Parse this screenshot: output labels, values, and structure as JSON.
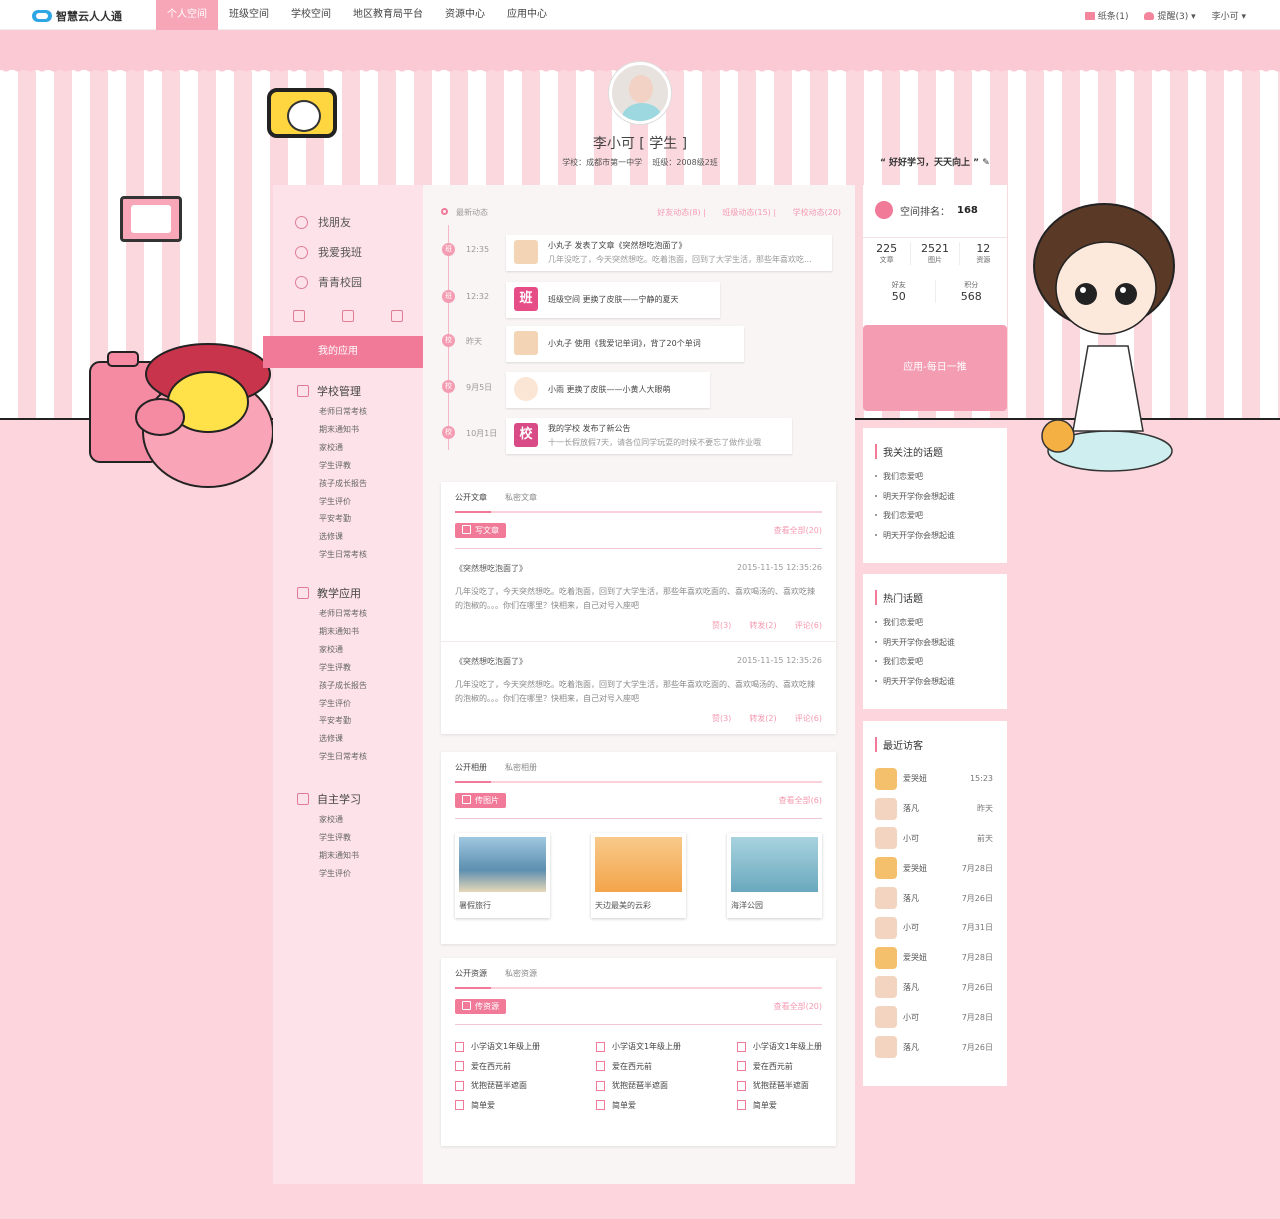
{
  "topnav": {
    "logo": "智慧云人人通",
    "items": [
      "个人空间",
      "班级空间",
      "学校空间",
      "地区教育局平台",
      "资源中心",
      "应用中心"
    ],
    "active_index": 0,
    "mail": "纸条(1)",
    "remind": "提醒(3)",
    "user": "李小可"
  },
  "profile": {
    "name": "李小可 [ 学生 ]",
    "school": "学校：成都市第一中学",
    "class": "班级：2008级2班",
    "motto": "“ 好好学习，天天向上 ”"
  },
  "sidebar": {
    "links": [
      "找朋友",
      "我爱我班",
      "青青校园"
    ],
    "myapp": "我的应用",
    "groups": [
      {
        "title": "学校管理",
        "items": [
          "老师日常考核",
          "期末通知书",
          "家校通",
          "学生评教",
          "孩子成长报告",
          "学生评价",
          "平安考勤",
          "选修课",
          "学生日常考核"
        ]
      },
      {
        "title": "教学应用",
        "items": [
          "老师日常考核",
          "期末通知书",
          "家校通",
          "学生评教",
          "孩子成长报告",
          "学生评价",
          "平安考勤",
          "选修课",
          "学生日常考核"
        ]
      },
      {
        "title": "自主学习",
        "items": [
          "家校通",
          "学生评教",
          "期末通知书",
          "学生评价"
        ]
      }
    ]
  },
  "timeline": {
    "head": "最新动态",
    "tabs": [
      "好友动态(8)",
      "班级动态(15)",
      "学校动态(20)"
    ],
    "items": [
      {
        "badge": "班",
        "time": "12:35",
        "line1": "小丸子  发表了文章《突然想吃泡面了》",
        "line2": "几年没吃了，今天突然想吃。吃着泡面，回到了大学生活，那些年喜欢吃..."
      },
      {
        "badge": "班",
        "time": "12:32",
        "line1": "班级空间    更换了皮肤——宁静的夏天",
        "avatar_text": "班"
      },
      {
        "badge": "校",
        "time": "昨天",
        "line1": "小丸子    使用《我爱记单词》，背了20个单词"
      },
      {
        "badge": "校",
        "time": "9月5日",
        "line1": "小雨    更换了皮肤——小黄人大眼萌"
      },
      {
        "badge": "校",
        "time": "10月1日",
        "line1": "我的学校  发布了新公告",
        "line2": "十一长假放假7天，请各位同学玩耍的时候不要忘了做作业哦",
        "avatar_text": "校"
      }
    ]
  },
  "articles": {
    "tabs": [
      "公开文章",
      "私密文章"
    ],
    "button": "写文章",
    "view_all": "查看全部(20)",
    "list": [
      {
        "title": "《突然想吃泡面了》",
        "date": "2015-11-15  12:35:26",
        "body": "几年没吃了，今天突然想吃。吃着泡面，回到了大学生活，那些年喜欢吃面的、喜欢喝汤的、喜欢吃辣的泡椒的。。。你们在哪里？快相来，自己对号入座吧",
        "stats": [
          "赞(3)",
          "转发(2)",
          "评论(6)"
        ]
      },
      {
        "title": "《突然想吃泡面了》",
        "date": "2015-11-15  12:35:26",
        "body": "几年没吃了，今天突然想吃。吃着泡面，回到了大学生活，那些年喜欢吃面的、喜欢喝汤的、喜欢吃辣的泡椒的。。。你们在哪里？快相来，自己对号入座吧",
        "stats": [
          "赞(3)",
          "转发(2)",
          "评论(6)"
        ]
      }
    ]
  },
  "albums": {
    "tabs": [
      "公开相册",
      "私密相册"
    ],
    "button": "传图片",
    "view_all": "查看全部(6)",
    "photos": [
      {
        "caption": "暑假旅行",
        "color": "#5d8fb0"
      },
      {
        "caption": "天边最美的云彩",
        "color": "#f3a54a"
      },
      {
        "caption": "海洋公园",
        "color": "#6aa8bd"
      }
    ]
  },
  "resources": {
    "tabs": [
      "公开资源",
      "私密资源"
    ],
    "button": "传资源",
    "view_all": "查看全部(20)",
    "columns": [
      [
        "小学语文1年级上册",
        "爱在西元前",
        "犹抱琵琶半遮面",
        "简单爱"
      ],
      [
        "小学语文1年级上册",
        "爱在西元前",
        "犹抱琵琶半遮面",
        "简单爱"
      ],
      [
        "小学语文1年级上册",
        "爱在西元前",
        "犹抱琵琶半遮面",
        "简单爱"
      ]
    ]
  },
  "rank": {
    "label": "空间排名：",
    "value": "168",
    "stats": [
      {
        "n": "225",
        "l": "文章"
      },
      {
        "n": "2521",
        "l": "图片"
      },
      {
        "n": "12",
        "l": "资源"
      }
    ],
    "stats2": [
      {
        "l": "好友",
        "n": "50"
      },
      {
        "l": "积分",
        "n": "568"
      }
    ],
    "push": "应用-每日一推"
  },
  "topics": {
    "title": "我关注的话题",
    "items": [
      "我们恋爱吧",
      "明天开学你会想起谁",
      "我们恋爱吧",
      "明天开学你会想起谁"
    ]
  },
  "hot": {
    "title": "热门话题",
    "items": [
      "我们恋爱吧",
      "明天开学你会想起谁",
      "我们恋爱吧",
      "明天开学你会想起谁"
    ]
  },
  "visitors": {
    "title": "最近访客",
    "list": [
      {
        "name": "爱哭妞",
        "time": "15:23"
      },
      {
        "name": "落凡",
        "time": "昨天"
      },
      {
        "name": "小可",
        "time": "前天"
      },
      {
        "name": "爱哭妞",
        "time": "7月28日"
      },
      {
        "name": "落凡",
        "time": "7月26日"
      },
      {
        "name": "小可",
        "time": "7月31日"
      },
      {
        "name": "爱哭妞",
        "time": "7月28日"
      },
      {
        "name": "落凡",
        "time": "7月26日"
      },
      {
        "name": "小可",
        "time": "7月28日"
      },
      {
        "name": "落凡",
        "time": "7月26日"
      }
    ]
  }
}
